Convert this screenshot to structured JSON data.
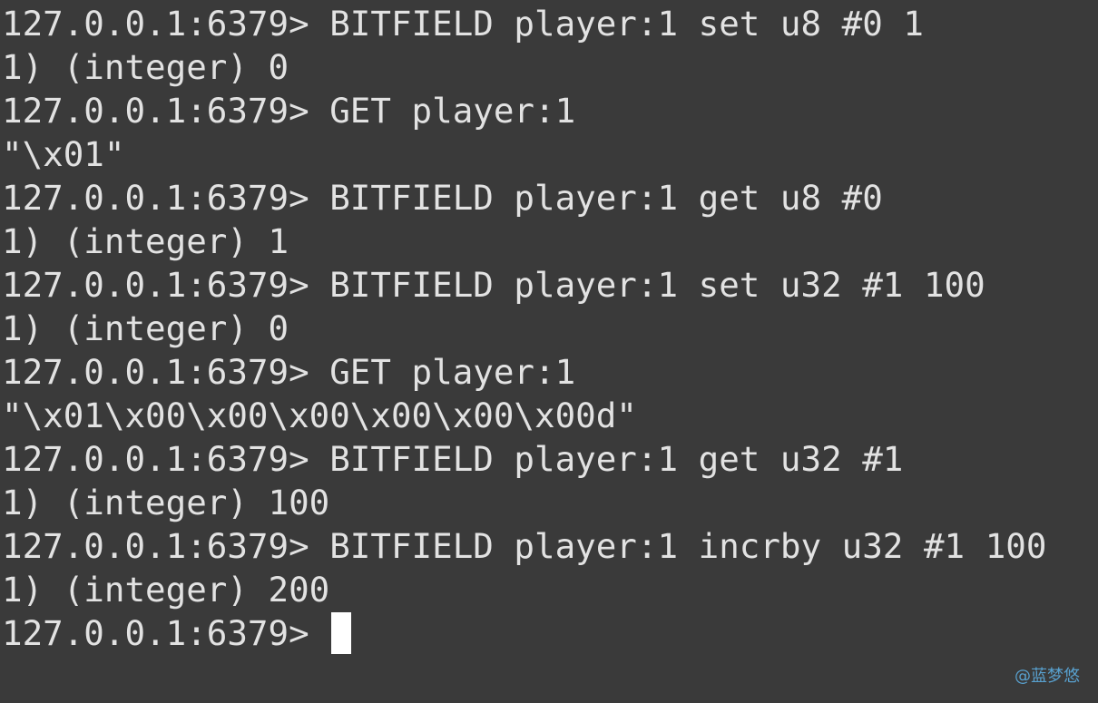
{
  "terminal": {
    "lines": [
      {
        "kind": "prompt",
        "prompt": "127.0.0.1:6379> ",
        "text": "BITFIELD player:1 set u8 #0 1"
      },
      {
        "kind": "output",
        "text": "1) (integer) 0"
      },
      {
        "kind": "prompt",
        "prompt": "127.0.0.1:6379> ",
        "text": "GET player:1"
      },
      {
        "kind": "output",
        "text": "\"\\x01\""
      },
      {
        "kind": "prompt",
        "prompt": "127.0.0.1:6379> ",
        "text": "BITFIELD player:1 get u8 #0"
      },
      {
        "kind": "output",
        "text": "1) (integer) 1"
      },
      {
        "kind": "prompt",
        "prompt": "127.0.0.1:6379> ",
        "text": "BITFIELD player:1 set u32 #1 100"
      },
      {
        "kind": "output",
        "text": "1) (integer) 0"
      },
      {
        "kind": "prompt",
        "prompt": "127.0.0.1:6379> ",
        "text": "GET player:1"
      },
      {
        "kind": "output",
        "text": "\"\\x01\\x00\\x00\\x00\\x00\\x00\\x00d\""
      },
      {
        "kind": "prompt",
        "prompt": "127.0.0.1:6379> ",
        "text": "BITFIELD player:1 get u32 #1"
      },
      {
        "kind": "output",
        "text": "1) (integer) 100"
      },
      {
        "kind": "prompt",
        "prompt": "127.0.0.1:6379> ",
        "text": "BITFIELD player:1 incrby u32 #1 100"
      },
      {
        "kind": "output",
        "text": "1) (integer) 200"
      }
    ],
    "current_prompt": "127.0.0.1:6379> ",
    "current_input": ""
  },
  "watermark": "@蓝梦悠",
  "colors": {
    "background": "#3a3a3a",
    "text": "#e2e2e2",
    "cursor": "#ffffff",
    "watermark": "#5aa6d6"
  }
}
